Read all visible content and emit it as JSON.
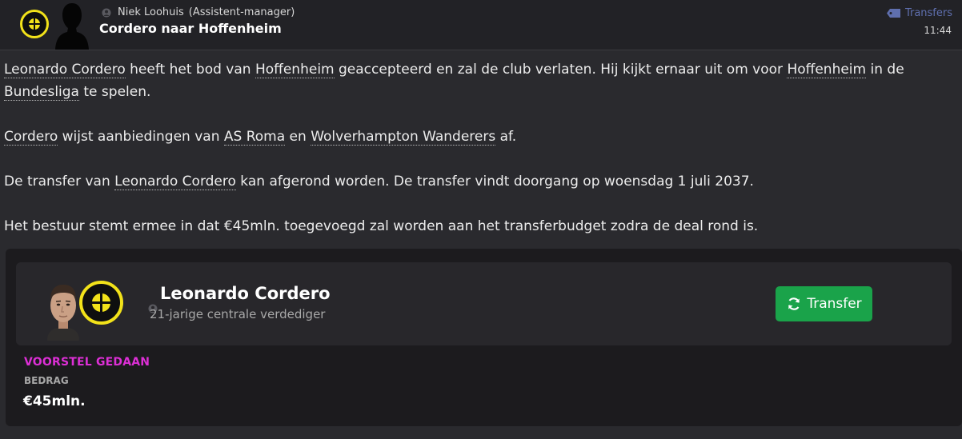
{
  "header": {
    "sender_name": "Niek Loohuis",
    "sender_role": "(Assistent-manager)",
    "subject": "Cordero naar Hoffenheim",
    "category": "Transfers",
    "time": "11:44"
  },
  "body": {
    "p1": {
      "player": "Leonardo Cordero",
      "t1": " heeft het bod van ",
      "club": "Hoffenheim",
      "t2": " geaccepteerd en zal de club verlaten. Hij kijkt ernaar uit om voor ",
      "club2": "Hoffenheim",
      "t3": " in de ",
      "league": "Bundesliga",
      "t4": " te spelen."
    },
    "p2": {
      "player": "Cordero",
      "t1": " wijst aanbiedingen van ",
      "club1": "AS Roma",
      "t2": " en ",
      "club2": "Wolverhampton Wanderers",
      "t3": " af."
    },
    "p3": {
      "t1": "De transfer van ",
      "player": "Leonardo Cordero",
      "t2": " kan afgerond worden. De transfer vindt doorgang op woensdag 1 juli 2037."
    },
    "p4": {
      "text": "Het bestuur stemt ermee in dat €45mln. toegevoegd zal worden aan het transferbudget zodra de deal rond is."
    }
  },
  "card": {
    "player_name": "Leonardo Cordero",
    "player_desc": "21-jarige centrale verdediger",
    "button_label": "Transfer",
    "status": "VOORSTEL GEDAAN",
    "amount_label": "BEDRAG",
    "amount_value": "€45mln."
  },
  "colors": {
    "accent_green": "#1aa34a",
    "status_magenta": "#dd2fd6",
    "badge_yellow": "#f2e21a",
    "category_blue": "#5f6fae"
  },
  "icons": [
    "club-badge-icon",
    "manager-silhouette-icon",
    "person-icon",
    "tag-icon",
    "player-face-icon",
    "refresh-icon"
  ]
}
